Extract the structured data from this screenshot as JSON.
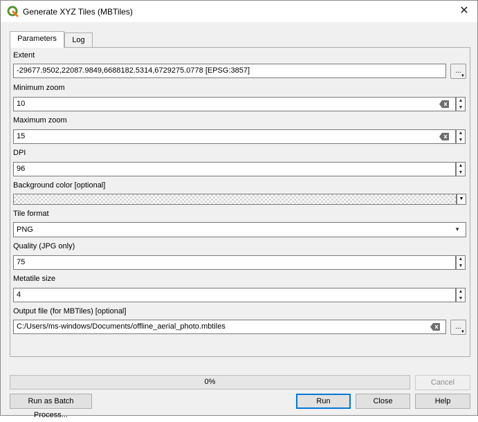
{
  "window": {
    "title": "Generate XYZ Tiles (MBTiles)"
  },
  "tabs": [
    {
      "label": "Parameters"
    },
    {
      "label": "Log"
    }
  ],
  "params": {
    "extent": {
      "label": "Extent",
      "value": "-29677.9502,22087.9849,6688182.5314,6729275.0778 [EPSG:3857]",
      "button": "..."
    },
    "min_zoom": {
      "label": "Minimum zoom",
      "value": "10"
    },
    "max_zoom": {
      "label": "Maximum zoom",
      "value": "15"
    },
    "dpi": {
      "label": "DPI",
      "value": "96"
    },
    "background_color": {
      "label": "Background color [optional]"
    },
    "tile_format": {
      "label": "Tile format",
      "value": "PNG"
    },
    "quality": {
      "label": "Quality (JPG only)",
      "value": "75"
    },
    "metatile": {
      "label": "Metatile size",
      "value": "4"
    },
    "output": {
      "label": "Output file (for MBTiles) [optional]",
      "value": "C:/Users/ms-windows/Documents/offline_aerial_photo.mbtiles",
      "button": "..."
    }
  },
  "progress": {
    "text": "0%",
    "value": 0
  },
  "buttons": {
    "cancel": "Cancel",
    "batch": "Run as Batch Process...",
    "run": "Run",
    "close": "Close",
    "help": "Help"
  },
  "colors": {
    "accent": "#0078d7",
    "qgis_green": "#589632",
    "qgis_yellow": "#ee7913"
  }
}
